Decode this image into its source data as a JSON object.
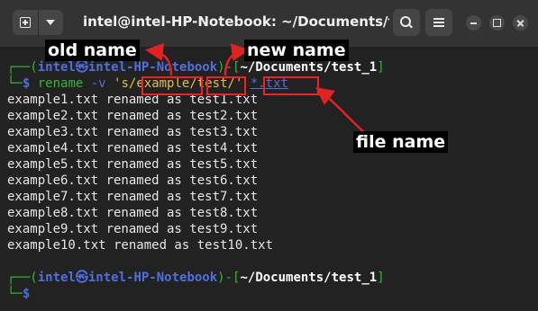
{
  "window": {
    "title": "intel@intel-HP-Notebook: ~/Documents/test...",
    "new_tab_icon": "new-tab-icon",
    "dropdown_icon": "chevron-down-icon",
    "search_icon": "search-icon",
    "menu_icon": "hamburger-menu-icon"
  },
  "prompt1": {
    "user": "intel",
    "host": "intel-HP-Notebook",
    "path": "~/Documents/test_1",
    "dollar": "$",
    "command": "rename",
    "flag": "-v",
    "quote_open": "'s/",
    "old": "example",
    "sep": "/",
    "new": "test",
    "quote_close": "/'",
    "glob": "*.txt"
  },
  "output_lines": [
    "example1.txt renamed as test1.txt",
    "example2.txt renamed as test2.txt",
    "example3.txt renamed as test3.txt",
    "example4.txt renamed as test4.txt",
    "example5.txt renamed as test5.txt",
    "example6.txt renamed as test6.txt",
    "example7.txt renamed as test7.txt",
    "example8.txt renamed as test8.txt",
    "example9.txt renamed as test9.txt",
    "example10.txt renamed as test10.txt"
  ],
  "prompt2": {
    "user": "intel",
    "host": "intel-HP-Notebook",
    "path": "~/Documents/test_1",
    "dollar": "$"
  },
  "annotations": {
    "old_name": "old name",
    "new_name": "new name",
    "file_name": "file name",
    "color": "#e22222"
  },
  "colors": {
    "prompt_green": "#2fba2f",
    "prompt_blue": "#4f6fe0",
    "string_yellow": "#e0c03a",
    "background": "#222222"
  }
}
